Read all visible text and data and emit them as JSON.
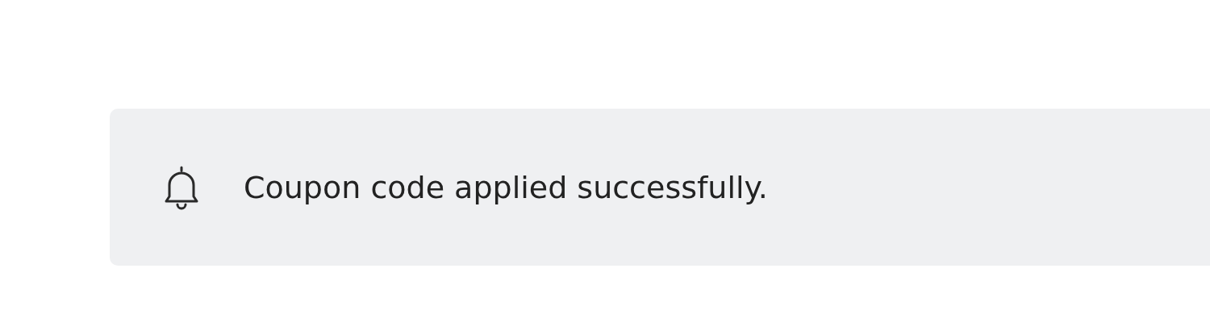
{
  "alert": {
    "kind": "info",
    "message": "Coupon code applied successfully."
  }
}
